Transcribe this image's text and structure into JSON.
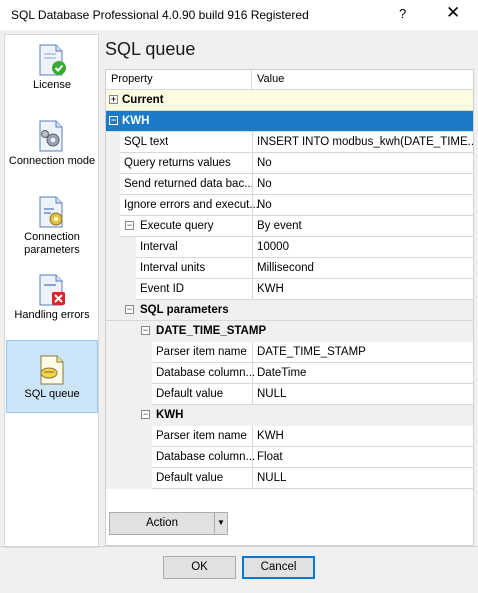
{
  "window": {
    "title": "SQL Database Professional 4.0.90 build 916 Registered",
    "help_glyph": "?",
    "close_glyph": "✕"
  },
  "sidebar": {
    "items": [
      {
        "label": "License",
        "icon": "license-icon"
      },
      {
        "label": "Connection mode",
        "icon": "connection-mode-icon"
      },
      {
        "label": "Connection parameters",
        "icon": "connection-parameters-icon"
      },
      {
        "label": "Handling errors",
        "icon": "handling-errors-icon"
      },
      {
        "label": "SQL queue",
        "icon": "sql-queue-icon",
        "selected": true
      }
    ]
  },
  "page": {
    "heading": "SQL queue"
  },
  "grid": {
    "col_property": "Property",
    "col_value": "Value",
    "categories": {
      "current": "Current",
      "kwh": "KWH"
    },
    "sql_text": {
      "label": "SQL text",
      "value": "INSERT INTO modbus_kwh(DATE_TIME..."
    },
    "query_returns": {
      "label": "Query returns values",
      "value": "No"
    },
    "send_returned": {
      "label": "Send returned data bac...",
      "value": "No"
    },
    "ignore_errors": {
      "label": "Ignore errors and execut...",
      "value": "No"
    },
    "execute_query": {
      "label": "Execute query",
      "value": "By event"
    },
    "interval": {
      "label": "Interval",
      "value": "10000"
    },
    "interval_units": {
      "label": "Interval units",
      "value": "Millisecond"
    },
    "event_id": {
      "label": "Event ID",
      "value": "KWH"
    },
    "sql_parameters": {
      "label": "SQL parameters"
    },
    "param1": {
      "name": "DATE_TIME_STAMP",
      "parser_item": {
        "label": "Parser item name",
        "value": "DATE_TIME_STAMP"
      },
      "db_column": {
        "label": "Database column...",
        "value": "DateTime"
      },
      "default_value": {
        "label": "Default value",
        "value": "NULL"
      }
    },
    "param2": {
      "name": "KWH",
      "parser_item": {
        "label": "Parser item name",
        "value": "KWH"
      },
      "db_column": {
        "label": "Database column...",
        "value": "Float"
      },
      "default_value": {
        "label": "Default value",
        "value": "NULL"
      }
    }
  },
  "buttons": {
    "action": "Action",
    "ok": "OK",
    "cancel": "Cancel"
  }
}
